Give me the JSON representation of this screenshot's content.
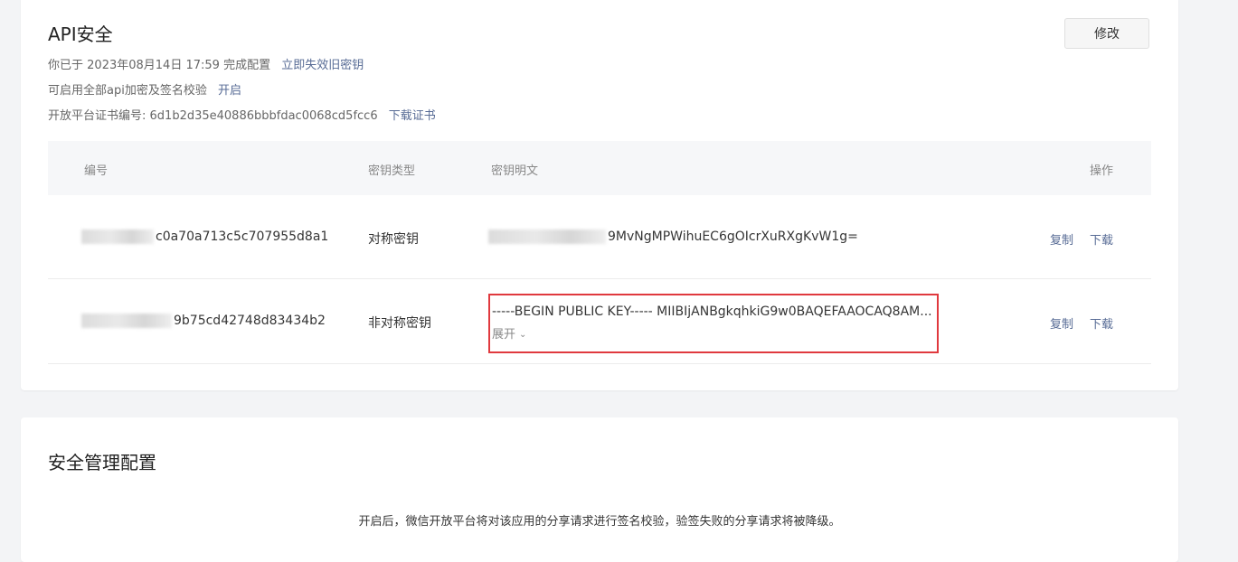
{
  "api_security": {
    "title": "API安全",
    "edit_button": "修改",
    "config_prefix": "你已于",
    "config_date": "2023年08月14日 17:59",
    "config_suffix": "完成配置",
    "invalidate_link": "立即失效旧密钥",
    "encrypt_text": "可启用全部api加密及签名校验",
    "enable_link": "开启",
    "cert_label": "开放平台证书编号:",
    "cert_number": "6d1b2d35e40886bbbfdac0068cd5fcc6",
    "download_cert_link": "下载证书",
    "table": {
      "headers": {
        "id": "编号",
        "key_type": "密钥类型",
        "key_plain": "密钥明文",
        "actions": "操作"
      },
      "rows": [
        {
          "id_suffix": "c0a70a713c5c707955d8a1",
          "key_type": "对称密钥",
          "key_plain_suffix": "9MvNgMPWihuEC6gOIcrXuRXgKvW1g=",
          "copy": "复制",
          "download": "下载"
        },
        {
          "id_suffix": "9b75cd42748d83434b2",
          "key_type": "非对称密钥",
          "key_plain": "-----BEGIN PUBLIC KEY----- MIIBIjANBgkqhkiG9w0BAQEFAAOCAQ8AM...",
          "expand": "展开",
          "copy": "复制",
          "download": "下载"
        }
      ]
    }
  },
  "security_management": {
    "title": "安全管理配置",
    "description": "开启后，微信开放平台将对该应用的分享请求进行签名校验，验签失败的分享请求将被降级。"
  },
  "colors": {
    "link": "#576b95",
    "highlight_border": "#e0393e",
    "page_bg": "#f3f4f6"
  }
}
